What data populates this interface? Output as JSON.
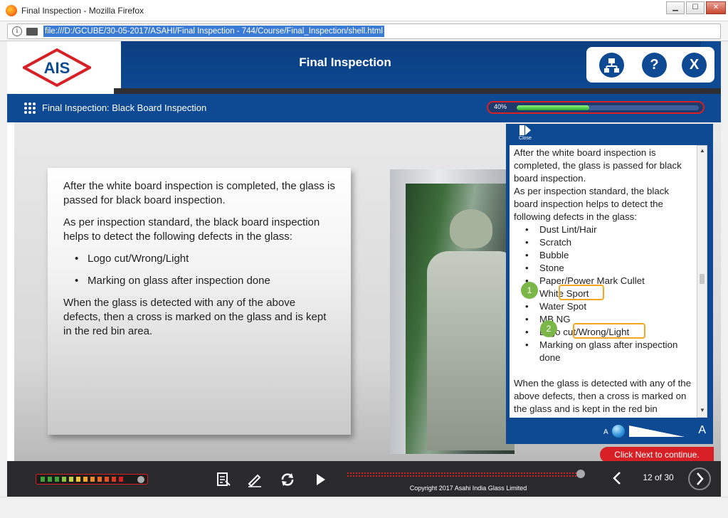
{
  "browser": {
    "window_title": "Final Inspection - Mozilla Firefox",
    "url": "file:///D:/GCUBE/30-05-2017/ASAHI/Final Inspection - 744/Course/Final_Inspection/shell.html",
    "minimize_label": "▁",
    "maximize_label": "☐",
    "close_label": "✕"
  },
  "header": {
    "logo_text": "AIS",
    "course_title": "Final Inspection",
    "nav": {
      "menu_icon": "sitemap-icon",
      "help_label": "?",
      "exit_label": "X"
    }
  },
  "subheader": {
    "page_title": "Final Inspection: Black Board Inspection",
    "progress_label": "40%",
    "progress_value": 0.4
  },
  "content": {
    "paragraph1": "After the white board inspection is completed, the glass is passed for black board inspection.",
    "paragraph2": "As per inspection standard, the black board inspection helps to detect the following defects in the glass:",
    "bullets": [
      "Logo cut/Wrong/Light",
      "Marking on glass after inspection done"
    ],
    "paragraph3": "When the glass is detected with any of the above defects, then a cross is marked on the glass and is kept in the red bin area."
  },
  "transcript": {
    "close_label": "Close",
    "intro1": "After the white board inspection is completed, the glass is passed for black board inspection.",
    "intro2": "As per inspection standard, the black board inspection helps to detect the following defects in the glass:",
    "defects": [
      "Dust Lint/Hair",
      "Scratch",
      "Bubble",
      "Stone",
      "Paper/Power Mark Cullet",
      "White Sport",
      "Water Spot",
      "MB NG",
      "Logo cut/Wrong/Light",
      "Marking on glass after inspection done"
    ],
    "outro": "When the glass is detected with any of the above defects, then a cross is marked on the glass and is kept in the red bin",
    "font_small_label": "A",
    "font_large_label": "A",
    "callouts": [
      "1",
      "2"
    ]
  },
  "prompt": "Click Next to continue.",
  "footer": {
    "copyright": "Copyright 2017 Asahi India Glass Limited",
    "page_indicator": "12 of 30"
  },
  "colors": {
    "brand_blue": "#0d4a93",
    "accent_red": "#d71f26",
    "callout_orange": "#f5a623",
    "badge_green": "#7ab648"
  }
}
